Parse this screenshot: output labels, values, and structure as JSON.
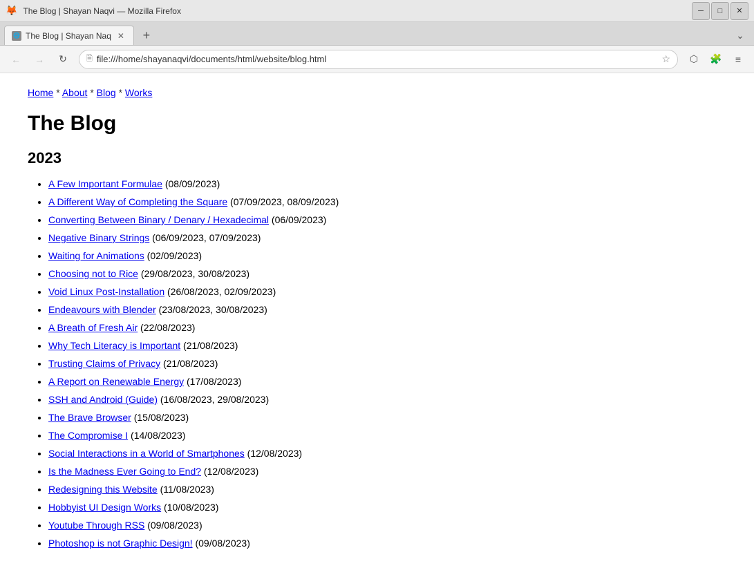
{
  "window": {
    "title": "The Blog | Shayan Naqvi — Mozilla Firefox"
  },
  "tab": {
    "title": "The Blog | Shayan Naq",
    "icon": "🌐"
  },
  "address_bar": {
    "url": "file:///home/shayanaqvi/documents/html/website/blog.html"
  },
  "nav": {
    "home_label": "Home",
    "about_label": "About",
    "blog_label": "Blog",
    "works_label": "Works",
    "separator": "*"
  },
  "page": {
    "title": "The Blog",
    "year": "2023",
    "posts": [
      {
        "title": "A Few Important Formulae",
        "date": "(08/09/2023)"
      },
      {
        "title": "A Different Way of Completing the Square",
        "date": "(07/09/2023, 08/09/2023)"
      },
      {
        "title": "Converting Between Binary / Denary / Hexadecimal",
        "date": "(06/09/2023)"
      },
      {
        "title": "Negative Binary Strings",
        "date": "(06/09/2023, 07/09/2023)"
      },
      {
        "title": "Waiting for Animations",
        "date": "(02/09/2023)"
      },
      {
        "title": "Choosing not to Rice",
        "date": "(29/08/2023, 30/08/2023)"
      },
      {
        "title": "Void Linux Post-Installation",
        "date": "(26/08/2023, 02/09/2023)"
      },
      {
        "title": "Endeavours with Blender",
        "date": "(23/08/2023, 30/08/2023)"
      },
      {
        "title": "A Breath of Fresh Air",
        "date": "(22/08/2023)"
      },
      {
        "title": "Why Tech Literacy is Important",
        "date": "(21/08/2023)"
      },
      {
        "title": "Trusting Claims of Privacy",
        "date": "(21/08/2023)"
      },
      {
        "title": "A Report on Renewable Energy",
        "date": "(17/08/2023)"
      },
      {
        "title": "SSH and Android (Guide)",
        "date": "(16/08/2023, 29/08/2023)"
      },
      {
        "title": "The Brave Browser",
        "date": "(15/08/2023)"
      },
      {
        "title": "The Compromise I",
        "date": "(14/08/2023)"
      },
      {
        "title": "Social Interactions in a World of Smartphones",
        "date": "(12/08/2023)"
      },
      {
        "title": "Is the Madness Ever Going to End?",
        "date": "(12/08/2023)"
      },
      {
        "title": "Redesigning this Website",
        "date": "(11/08/2023)"
      },
      {
        "title": "Hobbyist UI Design Works",
        "date": "(10/08/2023)"
      },
      {
        "title": "Youtube Through RSS",
        "date": "(09/08/2023)"
      },
      {
        "title": "Photoshop is not Graphic Design!",
        "date": "(09/08/2023)"
      }
    ]
  },
  "buttons": {
    "minimize": "─",
    "maximize": "□",
    "close": "✕",
    "back": "←",
    "forward": "→",
    "reload": "↻",
    "new_tab": "+",
    "bookmark": "☆",
    "pocket": "⬡",
    "extensions": "🧩",
    "menu": "≡",
    "tab_menu": "⌄"
  }
}
